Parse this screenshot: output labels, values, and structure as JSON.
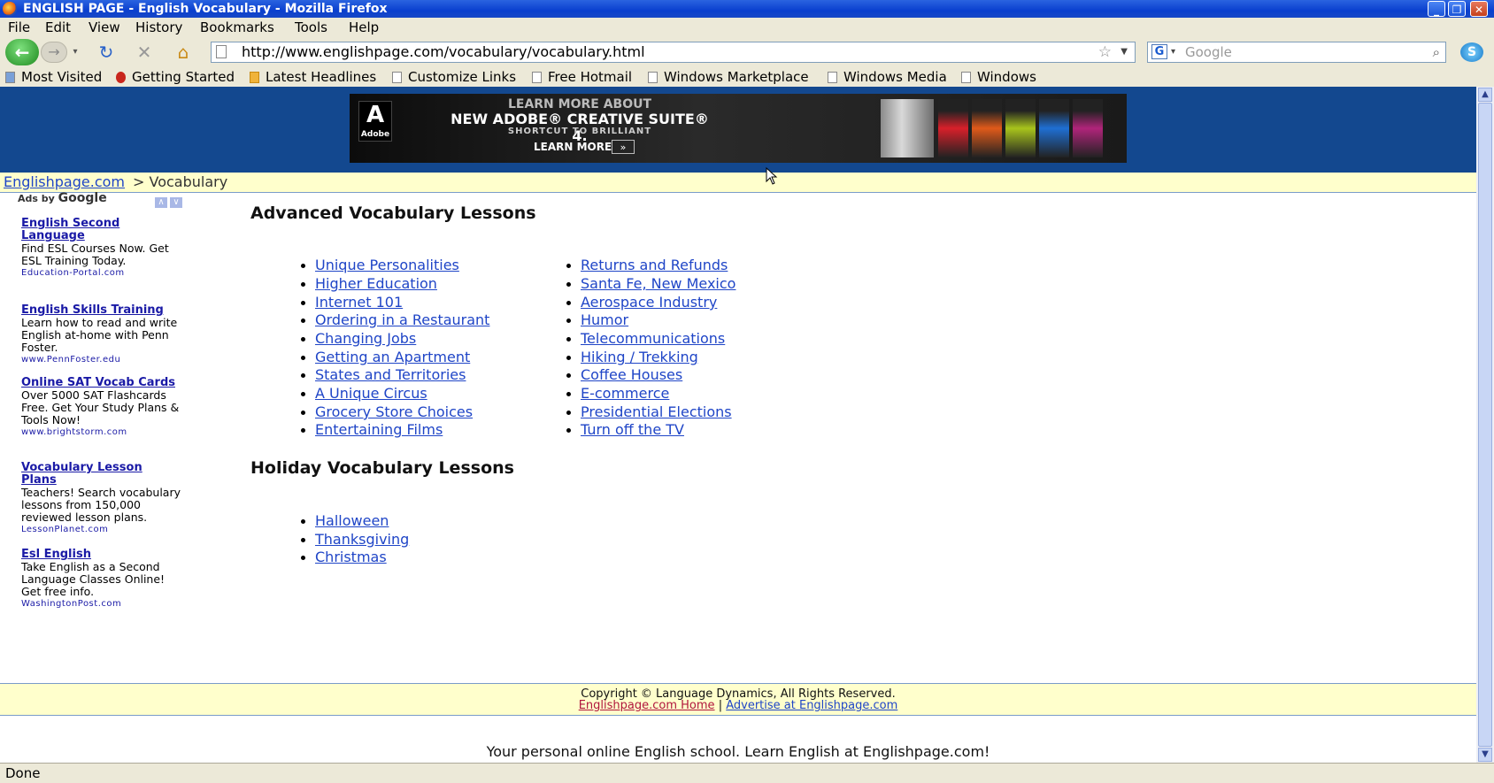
{
  "window": {
    "title": "ENGLISH PAGE - English Vocabulary - Mozilla Firefox"
  },
  "menu": [
    "File",
    "Edit",
    "View",
    "History",
    "Bookmarks",
    "Tools",
    "Help"
  ],
  "nav": {
    "url": "http://www.englishpage.com/vocabulary/vocabulary.html",
    "search_placeholder": "Google"
  },
  "bookmarks": [
    "Most Visited",
    "Getting Started",
    "Latest Headlines",
    "Customize Links",
    "Free Hotmail",
    "Windows Marketplace",
    "Windows Media",
    "Windows"
  ],
  "banner": {
    "brand": "Adobe",
    "line1": "LEARN MORE ABOUT",
    "line2": "NEW ADOBE® CREATIVE SUITE® 4.",
    "line3": "SHORTCUT TO BRILLIANT",
    "cta": "LEARN MORE"
  },
  "breadcrumb": {
    "home": "Englishpage.com",
    "current": "> Vocabulary"
  },
  "ads": {
    "header": "Ads by",
    "logo": "Google",
    "items": [
      {
        "title": "English Second Language",
        "body": "Find ESL Courses Now. Get ESL Training Today.",
        "url": "Education-Portal.com"
      },
      {
        "title": "English Skills Training",
        "body": "Learn how to read and write English at-home with Penn Foster.",
        "url": "www.PennFoster.edu"
      },
      {
        "title": "Online SAT Vocab Cards",
        "body": "Over 5000 SAT Flashcards Free. Get Your Study Plans & Tools Now!",
        "url": "www.brightstorm.com"
      },
      {
        "title": "Vocabulary Lesson Plans",
        "body": "Teachers! Search vocabulary lessons from 150,000 reviewed lesson plans.",
        "url": "LessonPlanet.com"
      },
      {
        "title": "Esl English",
        "body": "Take English as a Second Language Classes Online! Get free info.",
        "url": "WashingtonPost.com"
      }
    ]
  },
  "advanced": {
    "heading": "Advanced Vocabulary Lessons",
    "col1": [
      "Unique Personalities",
      "Higher Education",
      "Internet 101",
      "Ordering in a Restaurant",
      "Changing Jobs",
      "Getting an Apartment",
      "States and Territories",
      "A Unique Circus",
      "Grocery Store Choices",
      "Entertaining Films"
    ],
    "col2": [
      "Returns and Refunds",
      "Santa Fe, New Mexico",
      "Aerospace Industry",
      "Humor",
      "Telecommunications",
      "Hiking / Trekking",
      "Coffee Houses",
      "E-commerce",
      "Presidential Elections",
      "Turn off the TV"
    ]
  },
  "holiday": {
    "heading": "Holiday Vocabulary Lessons",
    "items": [
      "Halloween",
      "Thanksgiving",
      "Christmas"
    ]
  },
  "footer": {
    "copyright": "Copyright © Language Dynamics, All Rights Reserved.",
    "home_link": "Englishpage.com Home",
    "separator": "|",
    "advertise_link": "Advertise at Englishpage.com"
  },
  "tagline": "Your personal online English school. Learn English at Englishpage.com!",
  "status": "Done",
  "colors": {
    "titlebar": "#0a3fcf",
    "chrome": "#ece9d8",
    "banner": "#13488f",
    "link": "#1f45c7",
    "highlight": "#ffffcc"
  }
}
